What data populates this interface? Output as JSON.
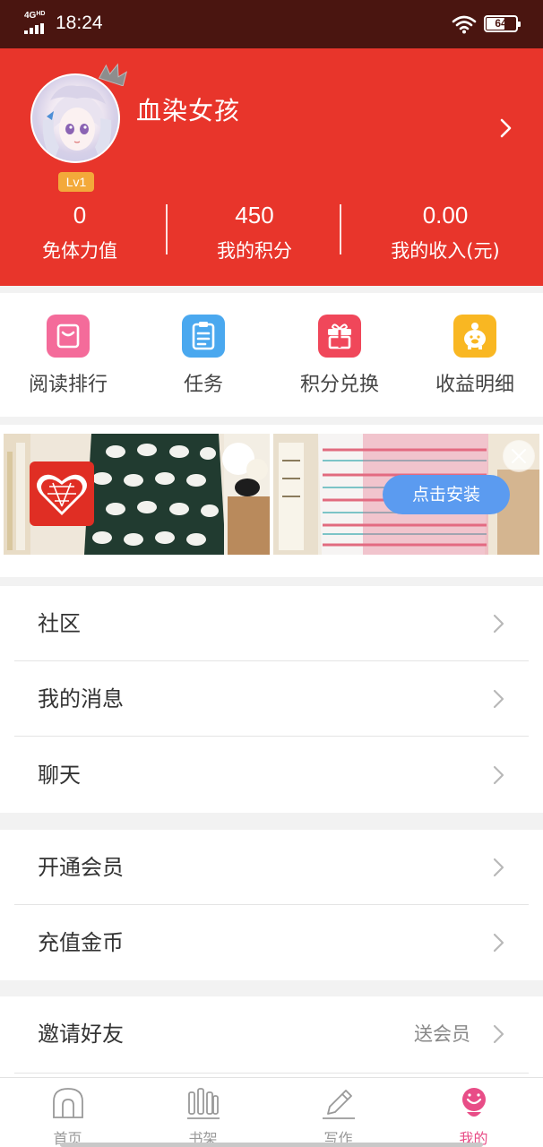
{
  "status_bar": {
    "network": "4G",
    "network_sub": "HD",
    "time": "18:24",
    "battery": "64",
    "battery_level": 0.64
  },
  "profile": {
    "username": "血染女孩",
    "level": "Lv1",
    "stats": [
      {
        "value": "0",
        "label": "免体力值"
      },
      {
        "value": "450",
        "label": "我的积分"
      },
      {
        "value": "0.00",
        "label": "我的收入(元)"
      }
    ],
    "theme_color": "#e8352b"
  },
  "quick_actions": [
    {
      "label": "阅读排行",
      "icon": "ranking-icon",
      "color": "#f46b9a"
    },
    {
      "label": "任务",
      "icon": "task-clipboard-icon",
      "color": "#4aa8ef"
    },
    {
      "label": "积分兑换",
      "icon": "gift-icon",
      "color": "#f0475a"
    },
    {
      "label": "收益明细",
      "icon": "piggy-bank-icon",
      "color": "#f9b722"
    }
  ],
  "ad": {
    "install_label": "点击安装"
  },
  "menu_groups": [
    [
      {
        "label": "社区"
      },
      {
        "label": "我的消息"
      },
      {
        "label": "聊天"
      }
    ],
    [
      {
        "label": "开通会员"
      },
      {
        "label": "充值金币"
      }
    ],
    [
      {
        "label": "邀请好友",
        "extra": "送会员"
      }
    ]
  ],
  "bottom_nav": [
    {
      "label": "首页",
      "icon": "home-icon",
      "active": false
    },
    {
      "label": "书架",
      "icon": "bookshelf-icon",
      "active": false
    },
    {
      "label": "写作",
      "icon": "pencil-icon",
      "active": false
    },
    {
      "label": "我的",
      "icon": "profile-icon",
      "active": true
    }
  ],
  "accent_color": "#e84d87"
}
